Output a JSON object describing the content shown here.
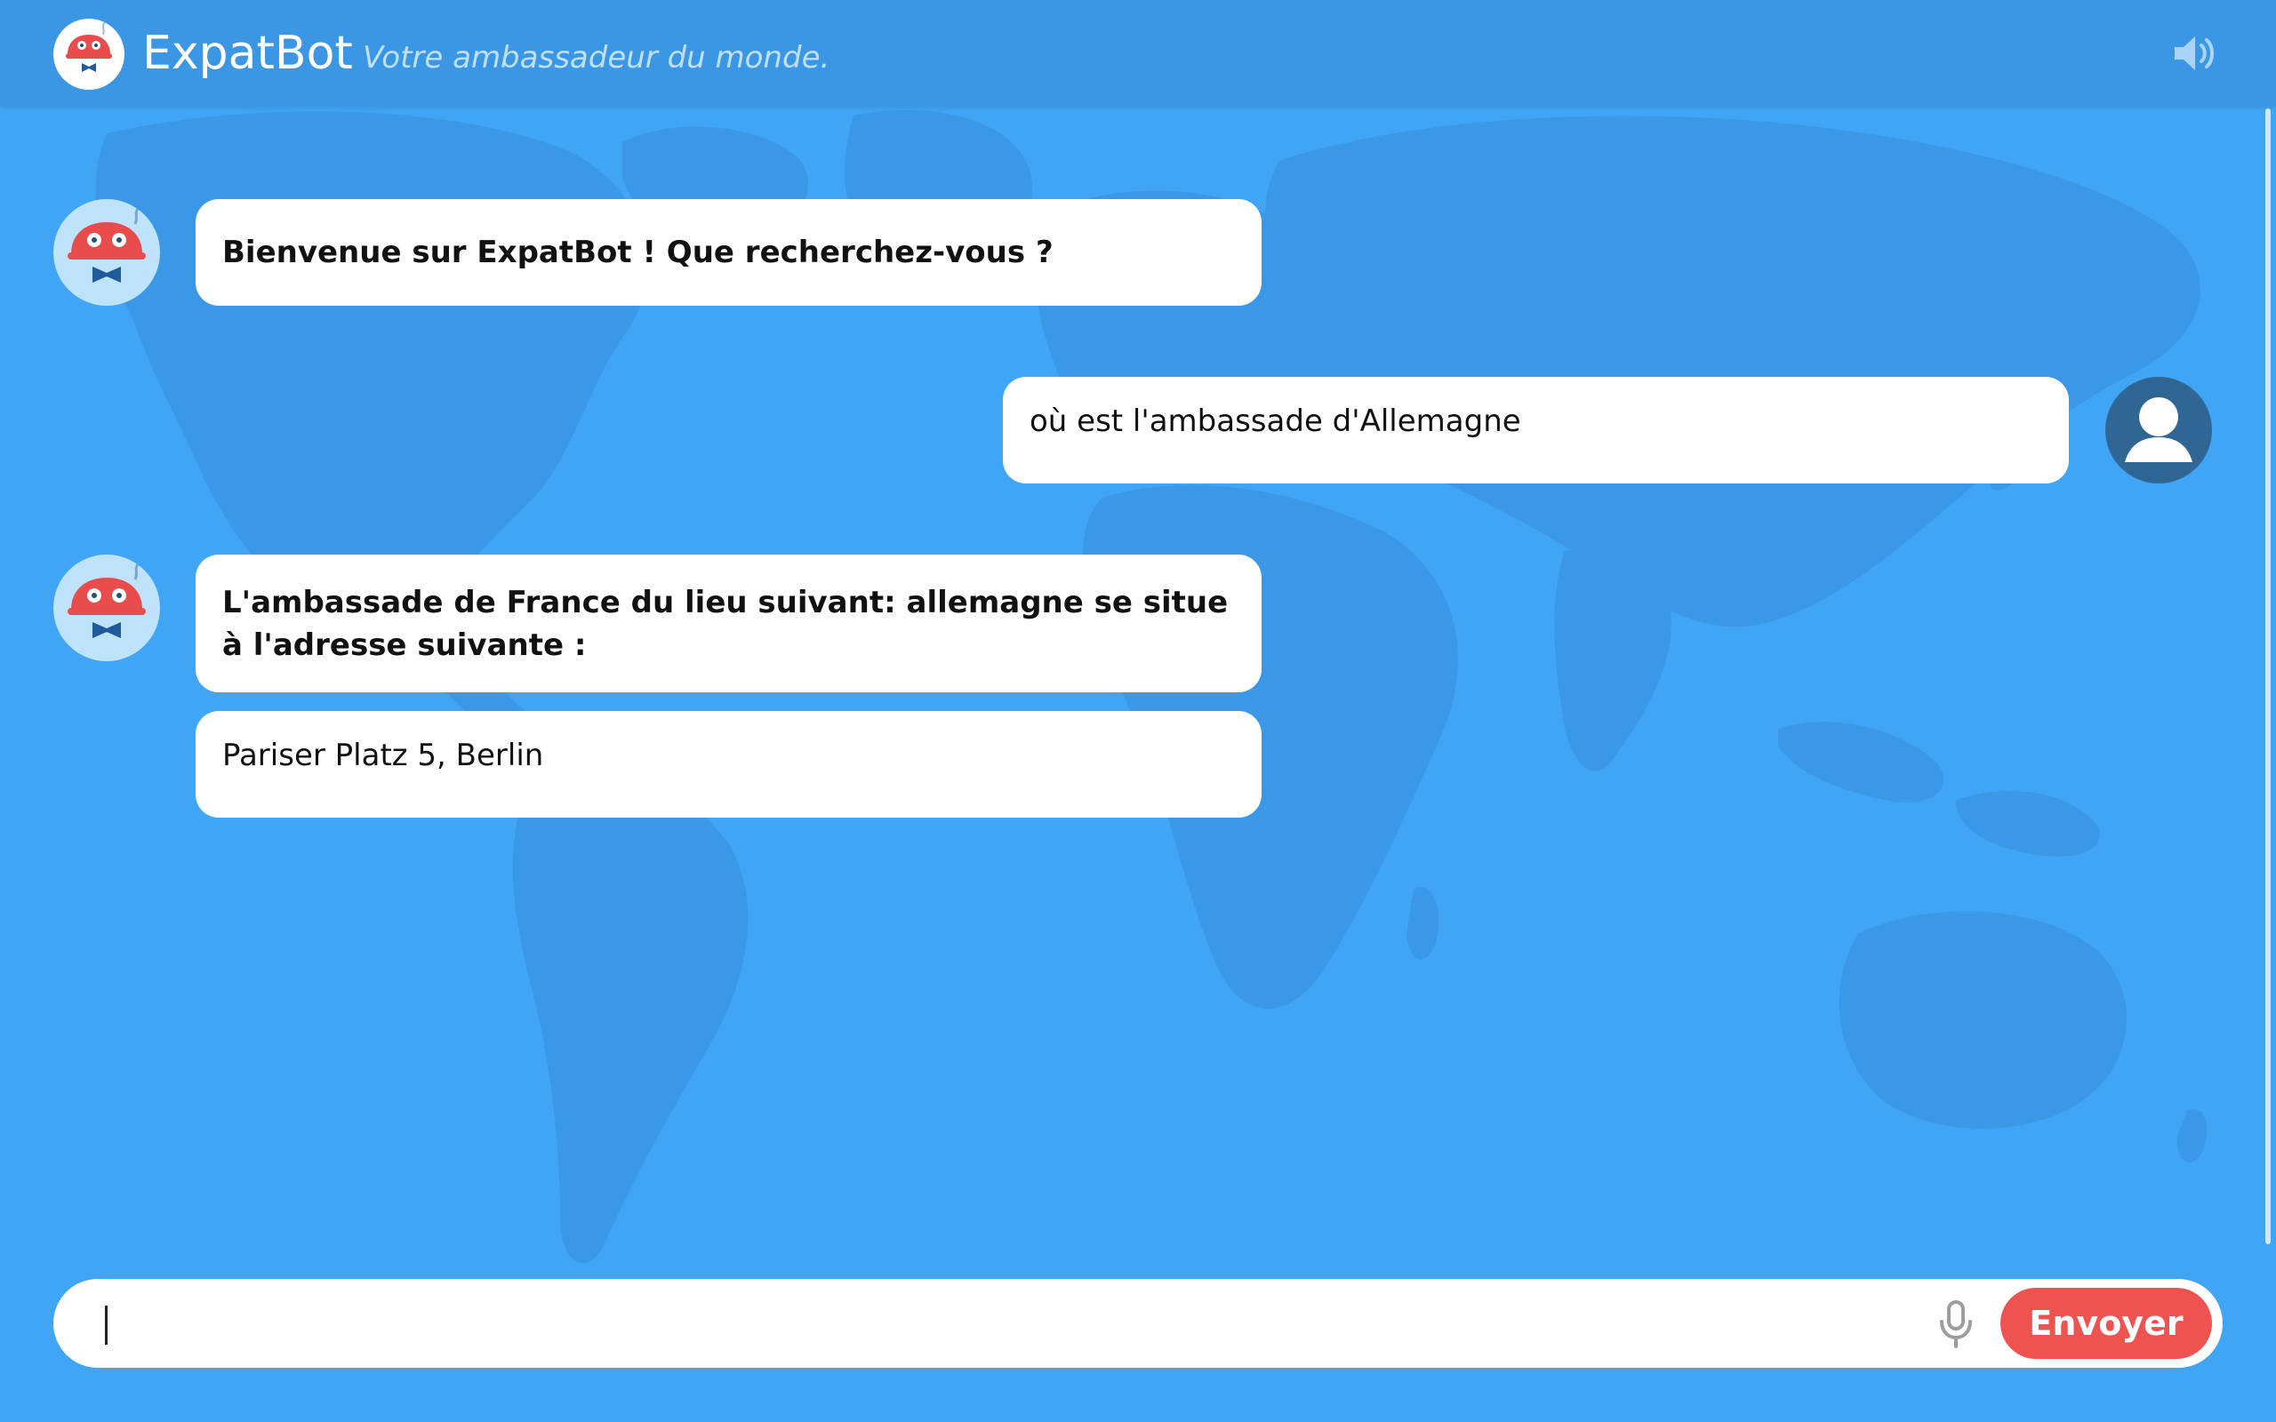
{
  "header": {
    "brand": "ExpatBot",
    "tagline": "Votre ambassadeur du monde."
  },
  "conversation": {
    "messages": [
      {
        "from": "bot",
        "text": "Bienvenue sur ExpatBot ! Que recherchez-vous ?"
      },
      {
        "from": "user",
        "text": "où est l'ambassade d'Allemagne"
      },
      {
        "from": "bot",
        "text": "L'ambassade de France du lieu suivant: allemagne se situe à l'adresse suivante :"
      },
      {
        "from": "bot",
        "text": "Pariser Platz 5, Berlin"
      }
    ]
  },
  "composer": {
    "value": "",
    "send_label": "Envoyer"
  },
  "icons": {
    "logo": "robot-mascot-icon",
    "sound": "speaker-icon",
    "user": "user-avatar-icon",
    "mic": "microphone-icon"
  },
  "colors": {
    "background": "#40a5f5",
    "header": "#3b97e3",
    "map_land": "#3b98e6",
    "bubble": "#ffffff",
    "send_button": "#ef5350",
    "bot_avatar_bg": "#bfe3fb",
    "user_avatar_bg": "#2f6694"
  }
}
